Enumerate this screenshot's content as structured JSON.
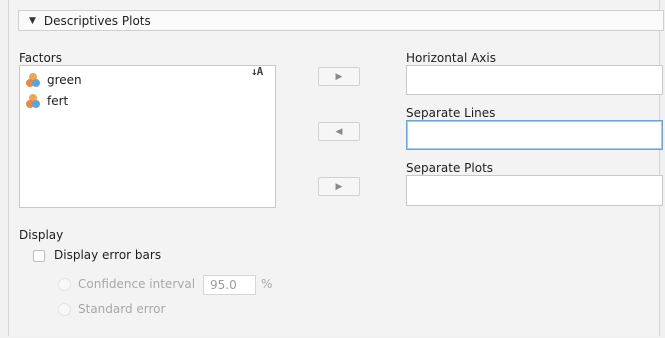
{
  "section": {
    "title": "Descriptives Plots",
    "toggle_icon": "triangle-down-icon"
  },
  "factors": {
    "label": "Factors",
    "items": [
      {
        "name": "green",
        "icon": "nominal-variable-icon"
      },
      {
        "name": "fert",
        "icon": "nominal-variable-icon"
      }
    ],
    "sort_icon": "sort-icon"
  },
  "buttons": {
    "move_horizontal": "▶",
    "move_lines": "◀",
    "move_plots": "▶"
  },
  "targets": {
    "horizontal_axis": {
      "label": "Horizontal Axis",
      "value": ""
    },
    "separate_lines": {
      "label": "Separate Lines",
      "value": ""
    },
    "separate_plots": {
      "label": "Separate Plots",
      "value": ""
    }
  },
  "display": {
    "label": "Display",
    "error_bars_label": "Display error bars",
    "error_bars_checked": false,
    "confidence_interval_label": "Confidence interval",
    "confidence_value": "95.0",
    "percent_sign": "%",
    "standard_error_label": "Standard error"
  },
  "colors": {
    "background": "#f3f3f3",
    "focus_border": "#6ca4d8",
    "icon_orange": "#f3a54e",
    "icon_blue": "#5ea3dc"
  }
}
